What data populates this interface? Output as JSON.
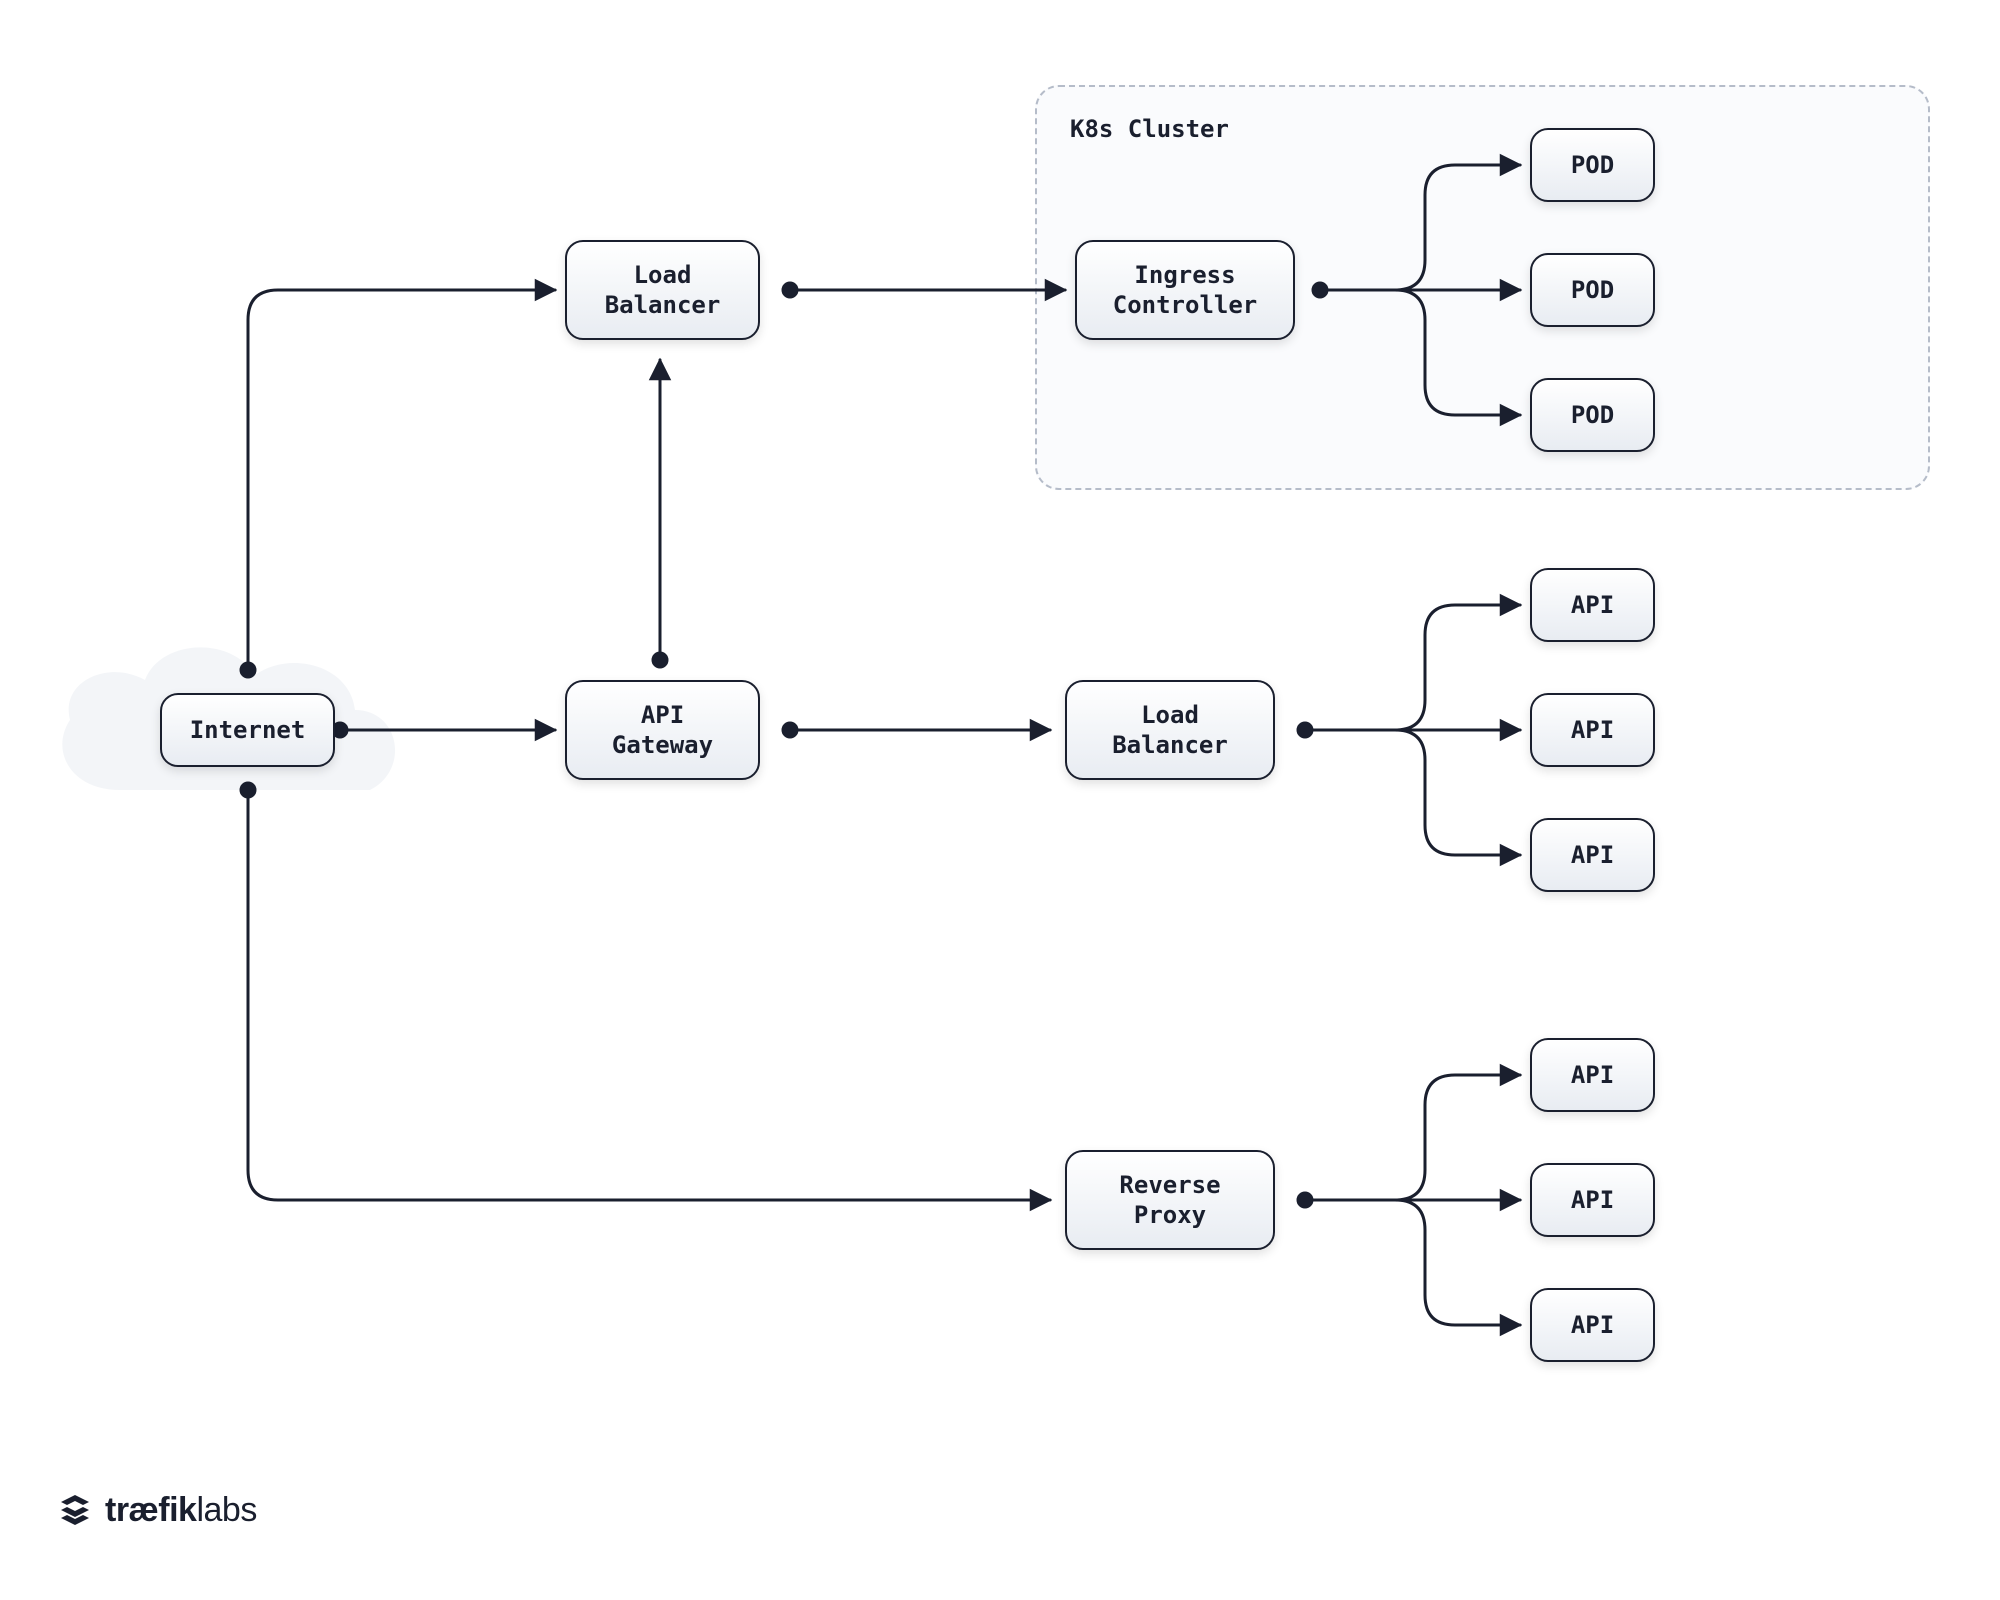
{
  "nodes": {
    "internet": "Internet",
    "load_balancer_top": "Load\nBalancer",
    "api_gateway": "API\nGateway",
    "ingress_controller": "Ingress\nController",
    "load_balancer_right": "Load\nBalancer",
    "reverse_proxy": "Reverse\nProxy",
    "pod1": "POD",
    "pod2": "POD",
    "pod3": "POD",
    "api1": "API",
    "api2": "API",
    "api3": "API",
    "api4": "API",
    "api5": "API",
    "api6": "API"
  },
  "cluster": {
    "title": "K8s Cluster"
  },
  "brand": {
    "text_bold": "træfik",
    "text_light": "labs"
  }
}
